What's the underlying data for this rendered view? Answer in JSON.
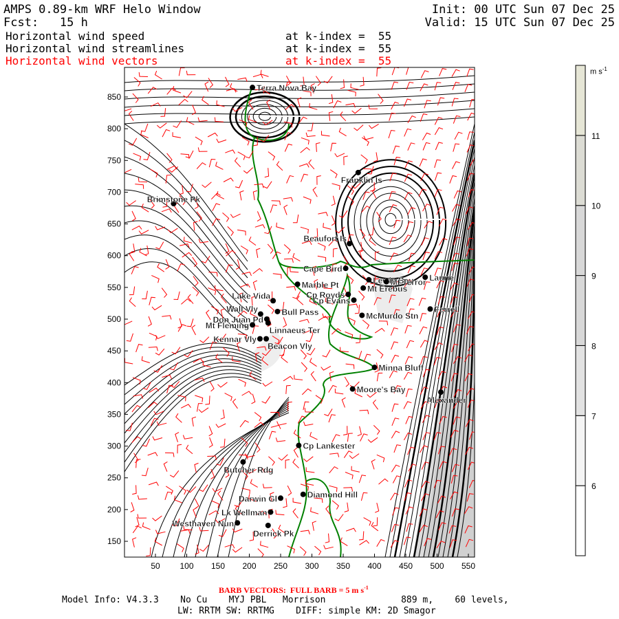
{
  "header": {
    "title": "AMPS 0.89-km WRF Helo Window",
    "forecast": "Fcst:   15 h",
    "init": "Init: 00 UTC Sun 07 Dec 25",
    "valid": "Valid: 15 UTC Sun 07 Dec 25",
    "fields": [
      {
        "name": "Horizontal wind speed",
        "level": "at k-index =  55"
      },
      {
        "name": "Horizontal wind streamlines",
        "level": "at k-index =  55"
      },
      {
        "name": "Horizontal wind vectors",
        "level": "at k-index =  55"
      }
    ]
  },
  "colors": {
    "barbs": "#ff0000",
    "coast": "#008000",
    "streamlines": "#000000"
  },
  "colorbar": {
    "unit": "m s",
    "unit_exp": "-1",
    "labels": [
      "6",
      "7",
      "8",
      "9",
      "10",
      "11"
    ],
    "fills": [
      "#ffffff",
      "#f4f4f4",
      "#e2e2e2",
      "#d8d8d8",
      "#d8d8d8",
      "#dcdcd4",
      "#e6e6d6"
    ]
  },
  "chart_data": {
    "type": "map",
    "xlim": [
      0,
      560
    ],
    "ylim": [
      125,
      886
    ],
    "xticks": [
      "50",
      "100",
      "150",
      "200",
      "250",
      "300",
      "350",
      "400",
      "450",
      "500",
      "550"
    ],
    "yticks": [
      "150",
      "200",
      "250",
      "300",
      "350",
      "400",
      "450",
      "500",
      "550",
      "600",
      "650",
      "700",
      "750",
      "800",
      "850"
    ],
    "stations": [
      {
        "name": "Terra Nova Bay",
        "x": 205,
        "y": 865,
        "side": "right"
      },
      {
        "name": "Franklin Is",
        "x": 374,
        "y": 731,
        "side": "below-left"
      },
      {
        "name": "Brimstone Pk",
        "x": 79,
        "y": 682,
        "side": "above"
      },
      {
        "name": "Beaufort Is",
        "x": 360,
        "y": 619,
        "side": "above-left"
      },
      {
        "name": "Cape Bird",
        "x": 354,
        "y": 580,
        "side": "left"
      },
      {
        "name": "Marble Pt",
        "x": 277,
        "y": 555,
        "side": "right"
      },
      {
        "name": "Lewis Bay",
        "x": 391,
        "y": 562,
        "side": "right"
      },
      {
        "name": "Mt Terror",
        "x": 419,
        "y": 559,
        "side": "right"
      },
      {
        "name": "Laurie",
        "x": 481,
        "y": 566,
        "side": "right"
      },
      {
        "name": "Mt Erebus",
        "x": 382,
        "y": 549,
        "side": "right"
      },
      {
        "name": "Cp Royds",
        "x": 358,
        "y": 539,
        "side": "left"
      },
      {
        "name": "Cp Evans",
        "x": 367,
        "y": 530,
        "side": "left"
      },
      {
        "name": "McMurdo Stn",
        "x": 380,
        "y": 506,
        "side": "right"
      },
      {
        "name": "Ferrell",
        "x": 489,
        "y": 516,
        "side": "right"
      },
      {
        "name": "Minna Bluff",
        "x": 400,
        "y": 424,
        "side": "right"
      },
      {
        "name": "Moore's Bay",
        "x": 365,
        "y": 390,
        "side": "right"
      },
      {
        "name": "Alexander",
        "x": 506,
        "y": 385,
        "side": "below"
      },
      {
        "name": "Lake Vida",
        "x": 238,
        "y": 529,
        "side": "above-left"
      },
      {
        "name": "Wall Vly",
        "x": 218,
        "y": 508,
        "side": "above-left"
      },
      {
        "name": "Bull Pass",
        "x": 245,
        "y": 512,
        "side": "right"
      },
      {
        "name": "Don Juan Pd",
        "x": 228,
        "y": 500,
        "side": "left"
      },
      {
        "name": "Mt Fleming",
        "x": 205,
        "y": 491,
        "side": "left"
      },
      {
        "name": "Linnaeus Ter",
        "x": 230,
        "y": 494,
        "side": "below-right"
      },
      {
        "name": "Kennar Vly",
        "x": 217,
        "y": 469,
        "side": "left"
      },
      {
        "name": "Beacon Vly",
        "x": 227,
        "y": 469,
        "side": "below-right"
      },
      {
        "name": "Cp Lankester",
        "x": 279,
        "y": 301,
        "side": "right"
      },
      {
        "name": "Butcher Rdg",
        "x": 190,
        "y": 275,
        "side": "below"
      },
      {
        "name": "Darwin Gl",
        "x": 250,
        "y": 218,
        "side": "left"
      },
      {
        "name": "Diamond Hill",
        "x": 286,
        "y": 224,
        "side": "right"
      },
      {
        "name": "Lk Wellman",
        "x": 234,
        "y": 196,
        "side": "left"
      },
      {
        "name": "Westhaven Nun",
        "x": 181,
        "y": 179,
        "side": "left"
      },
      {
        "name": "Derrick Pk",
        "x": 230,
        "y": 175,
        "side": "below"
      }
    ]
  },
  "footer": {
    "barb_note": "BARB VECTORS:  FULL BARB = 5 m s",
    "barb_exp": "-1",
    "model_info": "Model Info: V4.3.3    No Cu    MYJ PBL   Morrison              889 m,    60 levels,",
    "model_info2": "LW: RRTM SW: RRTMG    DIFF: simple KM: 2D Smagor"
  }
}
